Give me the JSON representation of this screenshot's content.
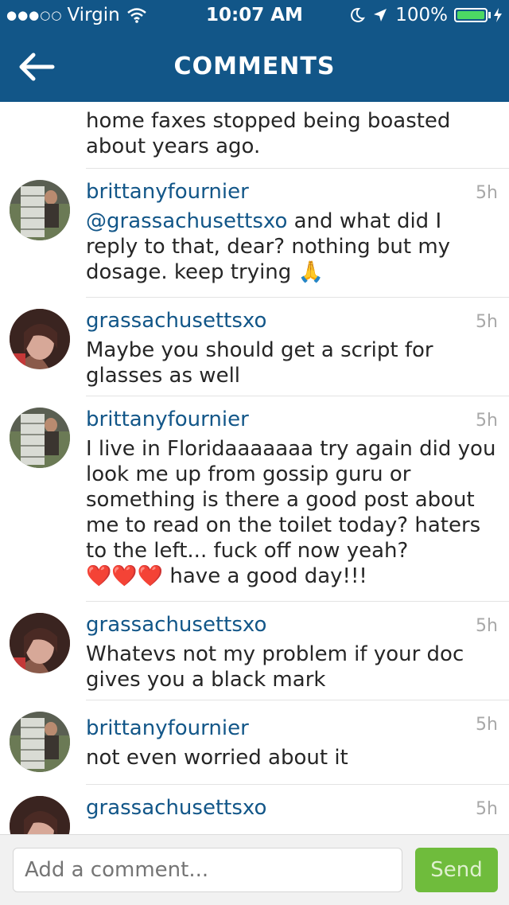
{
  "status_bar": {
    "signal": "●●●○○",
    "carrier": "Virgin",
    "time": "10:07 AM",
    "battery_percent": "100%"
  },
  "nav": {
    "title": "COMMENTS"
  },
  "comments": [
    {
      "username": "",
      "time": "",
      "text": "home faxes stopped being boasted about years ago."
    },
    {
      "username": "brittanyfournier",
      "time": "5h",
      "mention": "@grassachusettsxo",
      "text": " and what did I reply to that, dear? nothing but my dosage. keep trying ",
      "emoji": "🙏"
    },
    {
      "username": "grassachusettsxo",
      "time": "5h",
      "text": "Maybe you should get a script for glasses as well"
    },
    {
      "username": "brittanyfournier",
      "time": "5h",
      "text": "I live in Floridaaaaaaa try again did you look me up from gossip guru or something is there a good post about me to read on the toilet today? haters to the left... fuck off now yeah?",
      "emoji": "❤️❤️❤️",
      "text_end": " have a good day!!!"
    },
    {
      "username": "grassachusettsxo",
      "time": "5h",
      "text": "Whatevs not my problem if your doc gives you a black mark"
    },
    {
      "username": "brittanyfournier",
      "time": "5h",
      "text": "not even worried about it"
    },
    {
      "username": "grassachusettsxo",
      "time": "5h",
      "text": ""
    }
  ],
  "comment_bar": {
    "placeholder": "Add a comment...",
    "send_label": "Send"
  }
}
